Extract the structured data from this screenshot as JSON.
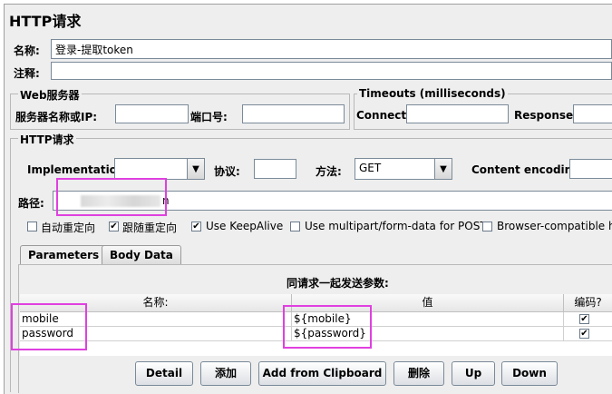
{
  "title": "HTTP请求",
  "name_label": "名称:",
  "name_value": "登录-提取token",
  "comment_label": "注释:",
  "web_server": {
    "legend": "Web服务器",
    "server_label": "服务器名称或IP:",
    "port_label": "端口号:"
  },
  "timeouts": {
    "legend": "Timeouts (milliseconds)",
    "connect_label": "Connect:",
    "response_label": "Response:"
  },
  "http_request": {
    "legend": "HTTP请求",
    "implementation_label": "Implementation:",
    "protocol_label": "协议:",
    "method_label": "方法:",
    "method_value": "GET",
    "encoding_label": "Content encoding:",
    "path_label": "路径:",
    "path_value_visible": "n"
  },
  "checkboxes": [
    {
      "label": "自动重定向",
      "checked": false
    },
    {
      "label": "跟随重定向",
      "checked": true
    },
    {
      "label": "Use KeepAlive",
      "checked": true
    },
    {
      "label": "Use multipart/form-data for POST",
      "checked": false
    },
    {
      "label": "Browser-compatible h",
      "checked": false
    }
  ],
  "tabs": [
    {
      "label": "Parameters",
      "active": true
    },
    {
      "label": "Body Data",
      "active": false
    }
  ],
  "params": {
    "caption": "同请求一起发送参数:",
    "columns": [
      "名称:",
      "值",
      "编码?"
    ],
    "rows": [
      {
        "name": "mobile",
        "value": "${mobile}",
        "encode": "✔"
      },
      {
        "name": "password",
        "value": "${password}",
        "encode": "✔"
      }
    ]
  },
  "buttons": {
    "detail": "Detail",
    "add": "添加",
    "add_clipboard": "Add from Clipboard",
    "delete": "删除",
    "up": "Up",
    "down": "Down"
  },
  "colors": {
    "highlight": "#e040e0",
    "panel_bg": "#eeeeee"
  }
}
